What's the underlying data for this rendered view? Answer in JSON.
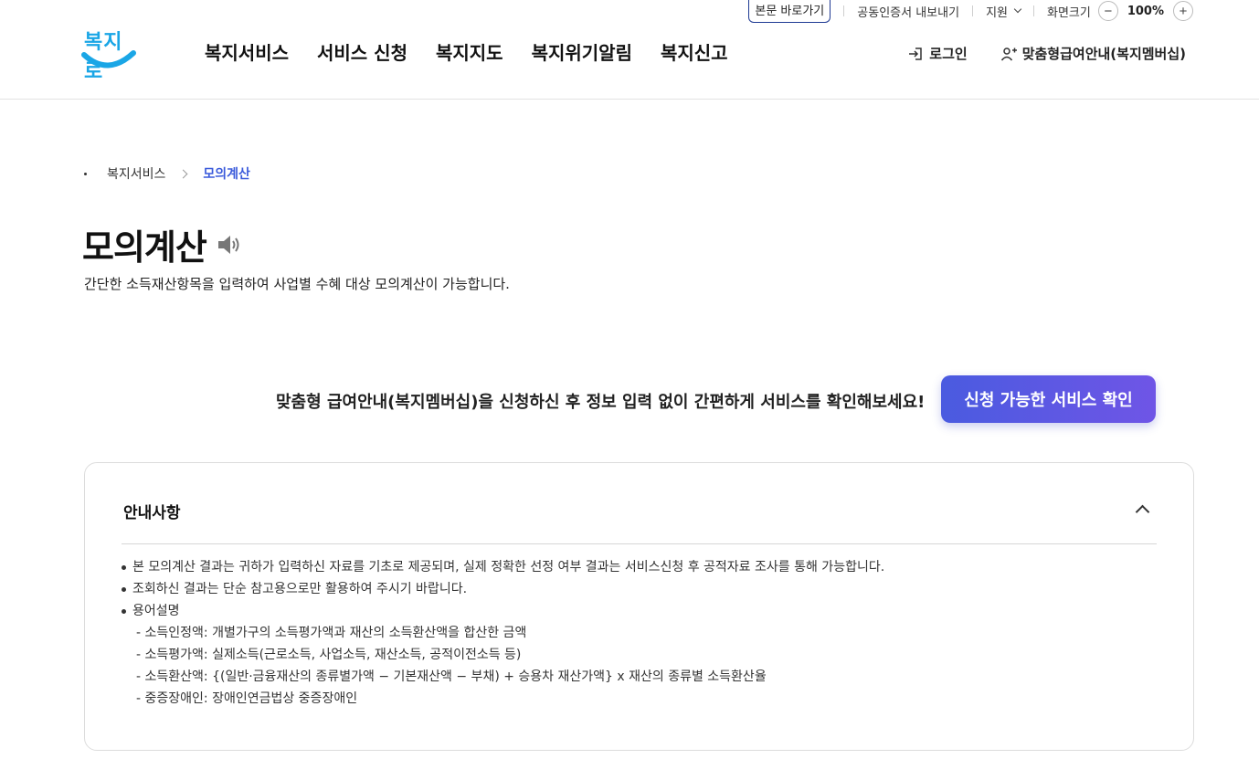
{
  "util_bar": {
    "skip_link": "본문 바로가기",
    "cert_export": "공동인증서 내보내기",
    "support": "지원",
    "screen_size": "화면크기",
    "zoom_minus": "−",
    "zoom_level": "100%",
    "zoom_plus": "+"
  },
  "header": {
    "logo_text": "복지로",
    "nav": [
      "복지서비스",
      "서비스 신청",
      "복지지도",
      "복지위기알림",
      "복지신고"
    ],
    "login": "로그인",
    "membership": "맞춤형급여안내(복지멤버십)"
  },
  "breadcrumb": {
    "parent": "복지서비스",
    "current": "모의계산"
  },
  "page": {
    "title": "모의계산",
    "description": "간단한 소득재산항목을 입력하여 사업별 수혜 대상 모의계산이 가능합니다."
  },
  "cta": {
    "text": "맞춤형 급여안내(복지멤버십)을 신청하신 후 정보 입력 없이 간편하게 서비스를 확인해보세요!",
    "button": "신청 가능한 서비스 확인"
  },
  "notice": {
    "title": "안내사항",
    "items": [
      "본 모의계산 결과는 귀하가 입력하신 자료를 기초로 제공되며, 실제 정확한 선정 여부 결과는 서비스신청 후 공적자료 조사를 통해 가능합니다.",
      "조회하신 결과는 단순 참고용으로만 활용하여 주시기 바랍니다.",
      "용어설명"
    ],
    "terms": [
      "- 소득인정액: 개별가구의 소득평가액과 재산의 소득환산액을 합산한 금액",
      "- 소득평가액: 실제소득(근로소득, 사업소득, 재산소득, 공적이전소득 등)",
      "- 소득환산액: {(일반·금융재산의 종류별가액 − 기본재산액 − 부채) + 승용차 재산가액} x 재산의 종류별 소득환산율",
      "- 중증장애인: 장애인연금법상 중증장애인"
    ]
  },
  "colors": {
    "brand_blue": "#1aa6e6",
    "accent": "#3b5bdb",
    "cta_gradient_start": "#4a5be0",
    "cta_gradient_end": "#6f55e6"
  }
}
